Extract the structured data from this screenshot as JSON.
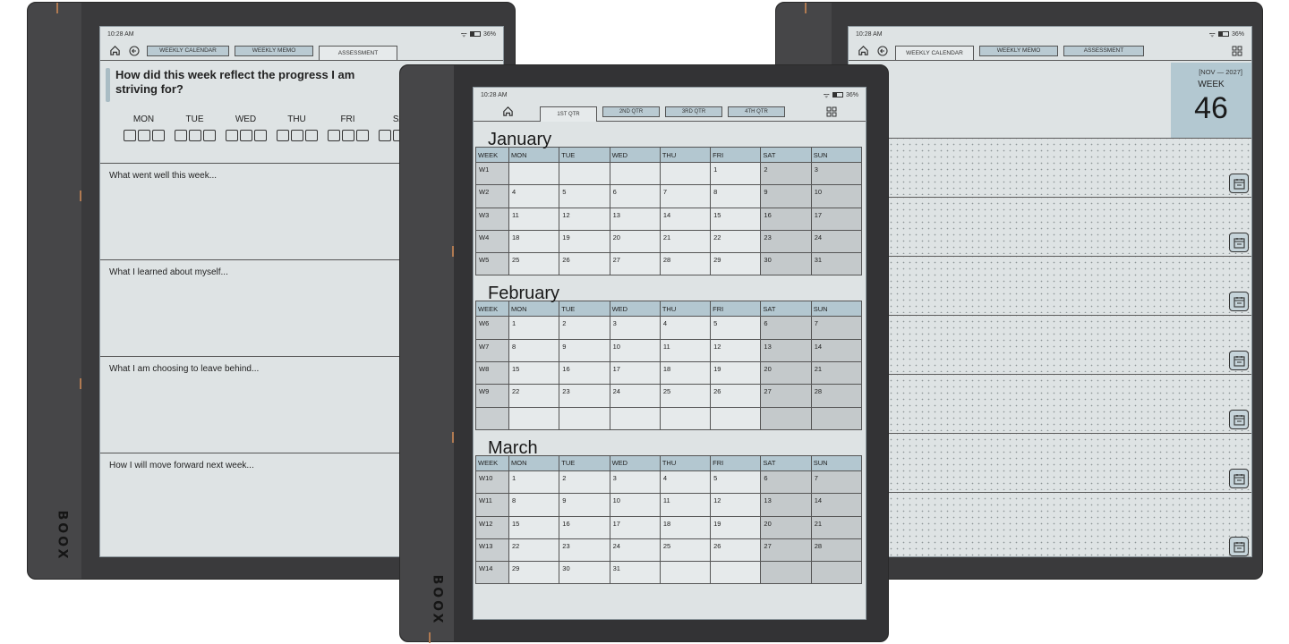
{
  "status": {
    "time": "10:28 AM",
    "battery": "36%"
  },
  "left": {
    "tabs": [
      "WEEKLY CALENDAR",
      "WEEKLY MEMO",
      "ASSESSMENT"
    ],
    "question": "How did this week reflect the progress I am striving for?",
    "days": [
      "MON",
      "TUE",
      "WED",
      "THU",
      "FRI",
      "SA"
    ],
    "prompts": [
      "What went well this week...",
      "What I learned about myself...",
      "What I am choosing to leave behind...",
      "How I will move forward next week..."
    ],
    "brand": "BOOX"
  },
  "right": {
    "tabs": [
      "WEEKLY CALENDAR",
      "WEEKLY MEMO",
      "ASSESSMENT"
    ],
    "week_range": "[NOV — 2027]",
    "week_label": "WEEK",
    "week_number": "46"
  },
  "center": {
    "tabs": [
      "1ST QTR",
      "2ND QTR",
      "3RD QTR",
      "4TH QTR"
    ],
    "brand": "BOOX",
    "headers": [
      "WEEK",
      "MON",
      "TUE",
      "WED",
      "THU",
      "FRI",
      "SAT",
      "SUN"
    ],
    "months": [
      {
        "name": "January",
        "rows": [
          [
            "W1",
            "",
            "",
            "",
            "",
            "1",
            "2",
            "3"
          ],
          [
            "W2",
            "4",
            "5",
            "6",
            "7",
            "8",
            "9",
            "10"
          ],
          [
            "W3",
            "11",
            "12",
            "13",
            "14",
            "15",
            "16",
            "17"
          ],
          [
            "W4",
            "18",
            "19",
            "20",
            "21",
            "22",
            "23",
            "24"
          ],
          [
            "W5",
            "25",
            "26",
            "27",
            "28",
            "29",
            "30",
            "31"
          ]
        ]
      },
      {
        "name": "February",
        "rows": [
          [
            "W6",
            "1",
            "2",
            "3",
            "4",
            "5",
            "6",
            "7"
          ],
          [
            "W7",
            "8",
            "9",
            "10",
            "11",
            "12",
            "13",
            "14"
          ],
          [
            "W8",
            "15",
            "16",
            "17",
            "18",
            "19",
            "20",
            "21"
          ],
          [
            "W9",
            "22",
            "23",
            "24",
            "25",
            "26",
            "27",
            "28"
          ],
          [
            "",
            "",
            "",
            "",
            "",
            "",
            "",
            ""
          ]
        ]
      },
      {
        "name": "March",
        "rows": [
          [
            "W10",
            "1",
            "2",
            "3",
            "4",
            "5",
            "6",
            "7"
          ],
          [
            "W11",
            "8",
            "9",
            "10",
            "11",
            "12",
            "13",
            "14"
          ],
          [
            "W12",
            "15",
            "16",
            "17",
            "18",
            "19",
            "20",
            "21"
          ],
          [
            "W13",
            "22",
            "23",
            "24",
            "25",
            "26",
            "27",
            "28"
          ],
          [
            "W14",
            "29",
            "30",
            "31",
            "",
            "",
            "",
            ""
          ]
        ]
      }
    ]
  },
  "colors": {
    "screen": "#dee3e4",
    "header_blue": "#b3c7d0",
    "body": "#3a3a3c",
    "accent": "#b07a52"
  },
  "icons": [
    "home-icon",
    "back-icon",
    "grid-icon",
    "wifi-icon",
    "battery-icon",
    "calendar-icon"
  ]
}
